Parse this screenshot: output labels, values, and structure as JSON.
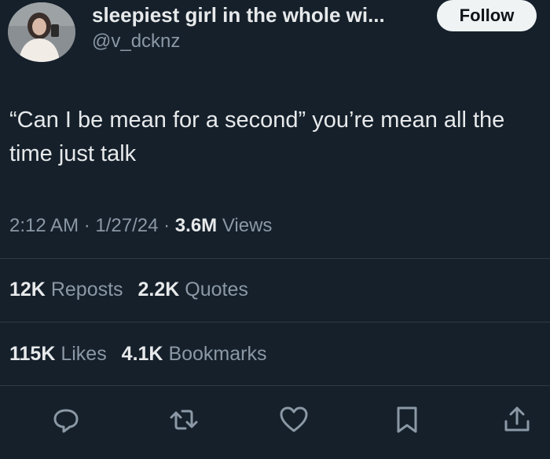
{
  "author": {
    "display_name": "sleepiest girl in the whole wi...",
    "handle": "@v_dcknz",
    "avatar_icon": "profile-photo",
    "follow_label": "Follow"
  },
  "tweet": {
    "text": "“Can I be mean for a second” you’re mean all the time just talk"
  },
  "meta": {
    "time": "2:12 AM",
    "sep1": " · ",
    "date": "1/27/24",
    "sep2": " · ",
    "views_count": "3.6M",
    "views_label": " Views"
  },
  "stats_row1": [
    {
      "count": "12K",
      "label": "Reposts"
    },
    {
      "count": "2.2K",
      "label": "Quotes"
    }
  ],
  "stats_row2": [
    {
      "count": "115K",
      "label": "Likes"
    },
    {
      "count": "4.1K",
      "label": "Bookmarks"
    }
  ],
  "actions": [
    {
      "icon": "reply-icon"
    },
    {
      "icon": "repost-icon"
    },
    {
      "icon": "like-icon"
    },
    {
      "icon": "bookmark-icon"
    },
    {
      "icon": "share-icon"
    }
  ],
  "colors": {
    "background": "#15202b",
    "primary_text": "#e7e9ea",
    "secondary_text": "#8b98a5",
    "divider": "#2f3a45",
    "follow_bg": "#eff3f4"
  }
}
